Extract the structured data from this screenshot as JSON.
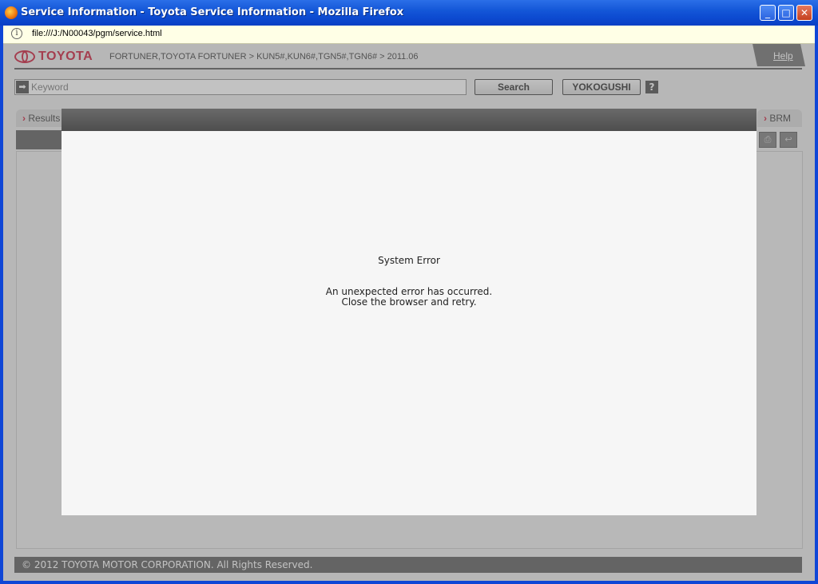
{
  "window": {
    "title": "Service Information - Toyota Service Information - Mozilla Firefox",
    "minimize": "_",
    "maximize": "□",
    "close": "✕"
  },
  "address": {
    "url": "file:///J:/N00043/pgm/service.html",
    "info_icon": "i"
  },
  "header": {
    "logo_text": "TOYOTA",
    "breadcrumb": "FORTUNER,TOYOTA FORTUNER > KUN5#,KUN6#,TGN5#,TGN6# > 2011.06",
    "help_label": "Help"
  },
  "search": {
    "placeholder": "Keyword",
    "search_label": "Search",
    "yokogushi_label": "YOKOGUSHI",
    "help_mark": "?"
  },
  "tabs": {
    "results_label": "Results",
    "brm_label": "BRM",
    "chevron": "›"
  },
  "modal": {
    "title": "System Error",
    "message_line1": "An unexpected error has occurred.",
    "message_line2": "Close the browser and retry."
  },
  "footer": {
    "copyright": "© 2012 TOYOTA MOTOR CORPORATION. All Rights Reserved."
  },
  "colors": {
    "brand": "#c8102e",
    "titlebar": "#0c4ad0",
    "modal_header": "#5a5a5a"
  },
  "icons": [
    "firefox-icon",
    "minimize-icon",
    "maximize-icon",
    "close-icon",
    "info-icon",
    "toyota-logo-icon",
    "arrow-icon",
    "help-icon",
    "chevron-icon",
    "print-icon",
    "back-icon"
  ]
}
